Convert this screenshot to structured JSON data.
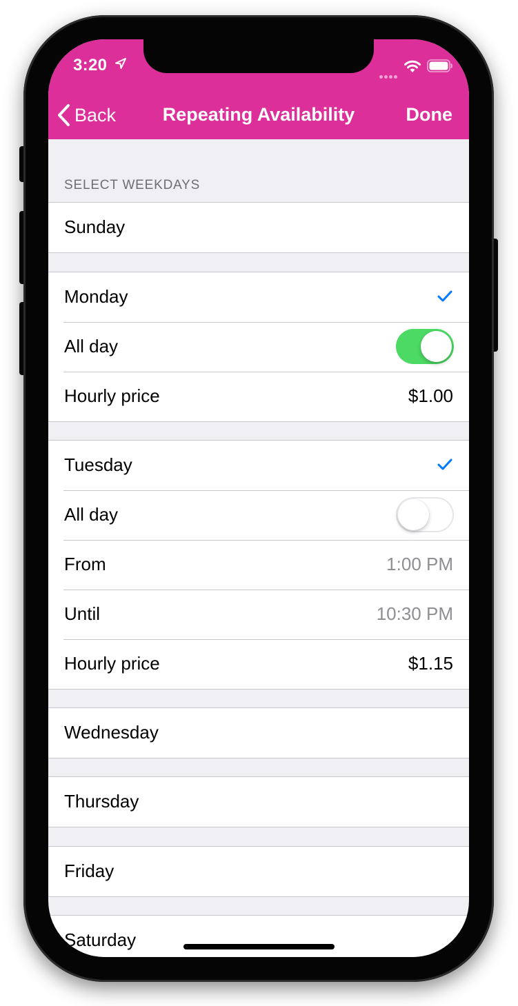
{
  "status_bar": {
    "time": "3:20",
    "location_icon": "location-arrow-icon",
    "wifi_icon": "wifi-icon",
    "battery_icon": "battery-icon"
  },
  "nav": {
    "back_label": "Back",
    "title": "Repeating Availability",
    "done_label": "Done"
  },
  "section_header": "SELECT WEEKDAYS",
  "days": {
    "sunday": {
      "label": "Sunday"
    },
    "monday": {
      "label": "Monday",
      "selected": true,
      "all_day_label": "All day",
      "all_day": true,
      "price_label": "Hourly price",
      "price": "$1.00"
    },
    "tuesday": {
      "label": "Tuesday",
      "selected": true,
      "all_day_label": "All day",
      "all_day": false,
      "from_label": "From",
      "from": "1:00 PM",
      "until_label": "Until",
      "until": "10:30 PM",
      "price_label": "Hourly price",
      "price": "$1.15"
    },
    "wednesday": {
      "label": "Wednesday"
    },
    "thursday": {
      "label": "Thursday"
    },
    "friday": {
      "label": "Friday"
    },
    "saturday": {
      "label": "Saturday"
    }
  },
  "colors": {
    "header": "#dc2f9a",
    "toggle_on": "#4cd964",
    "checkmark": "#007aff",
    "background": "#efeff4"
  }
}
